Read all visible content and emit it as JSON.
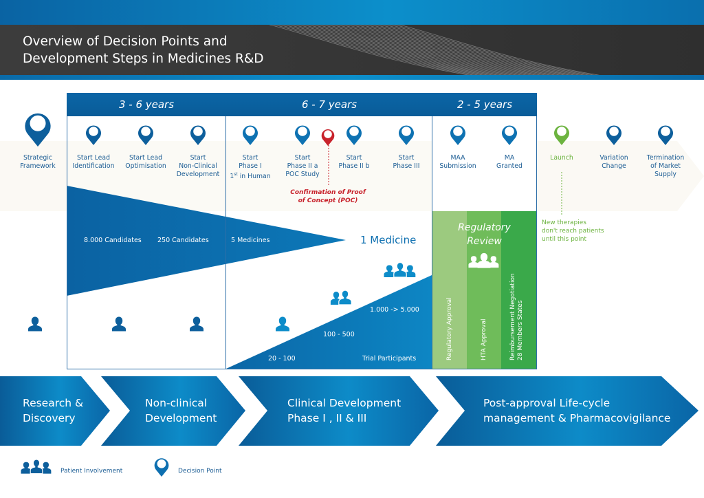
{
  "header": {
    "title_line1": "Overview of Decision Points and",
    "title_line2": "Development Steps in Medicines R&D"
  },
  "colors": {
    "primary_blue": "#0a65a6",
    "light_blue": "#0d8cc9",
    "poc_red": "#c8232c",
    "launch_green": "#6cb33f",
    "reg_green_1": "#9cca7f",
    "reg_green_2": "#6fbc5a",
    "reg_green_3": "#3aa94a"
  },
  "durations": [
    {
      "label": "3 - 6 years"
    },
    {
      "label": "6 - 7 years"
    },
    {
      "label": "2 - 5 years"
    }
  ],
  "milestones": [
    {
      "line1": "Strategic",
      "line2": "Framework",
      "line3": "",
      "type": "decision-large"
    },
    {
      "line1": "Start Lead",
      "line2": "Identification",
      "line3": "",
      "type": "decision"
    },
    {
      "line1": "Start Lead",
      "line2": "Optimisation",
      "line3": "",
      "type": "decision"
    },
    {
      "line1": "Start",
      "line2": "Non-Clinical",
      "line3": "Development",
      "type": "decision"
    },
    {
      "line1": "Start",
      "line2": "Phase I",
      "line3_pre": "1",
      "line3_sup": "st",
      "line3_post": " in Human",
      "type": "decision"
    },
    {
      "line1": "Start",
      "line2": "Phase II a",
      "line3": "POC Study",
      "type": "decision"
    },
    {
      "line1": "Start",
      "line2": "Phase II b",
      "line3": "",
      "type": "decision"
    },
    {
      "line1": "Start",
      "line2": "Phase III",
      "line3": "",
      "type": "decision"
    },
    {
      "line1": "MAA",
      "line2": "Submission",
      "line3": "",
      "type": "decision"
    },
    {
      "line1": "MA",
      "line2": "Granted",
      "line3": "",
      "type": "decision"
    },
    {
      "line1": "Launch",
      "line2": "",
      "line3": "",
      "type": "launch"
    },
    {
      "line1": "Variation",
      "line2": "Change",
      "line3": "",
      "type": "decision"
    },
    {
      "line1": "Termination",
      "line2": "of Market",
      "line3": "Supply",
      "type": "decision"
    }
  ],
  "poc": {
    "line1": "Confirmation of Proof",
    "line2": "of Concept (POC)"
  },
  "launch_note": {
    "line1": "New therapies",
    "line2": "don't reach patients",
    "line3": "until this point"
  },
  "funnel": {
    "stage1": "8.000 Candidates",
    "stage2": "250 Candidates",
    "stage3": "5 Medicines",
    "result": "1 Medicine"
  },
  "trials": {
    "phase1": "20 - 100",
    "phase2": "100 - 500",
    "phase3": "1.000 -> 5.000",
    "label": "Trial Participants"
  },
  "regulatory": {
    "title_line1": "Regulatory",
    "title_line2": "Review",
    "col1": "Regulatory Approval",
    "col2": "HTA Approval",
    "col3_line1": "Reimbursement Negotiation",
    "col3_line2": "28 Members States"
  },
  "stages": [
    {
      "line1": "Research &",
      "line2": "Discovery"
    },
    {
      "line1": "Non-clinical",
      "line2": "Development"
    },
    {
      "line1": "Clinical Development",
      "line2": "Phase I , II & III"
    },
    {
      "line1": "Post-approval Life-cycle",
      "line2": "management & Pharmacovigilance"
    }
  ],
  "legend": {
    "patient": "Patient Involvement",
    "decision": "Decision Point"
  }
}
